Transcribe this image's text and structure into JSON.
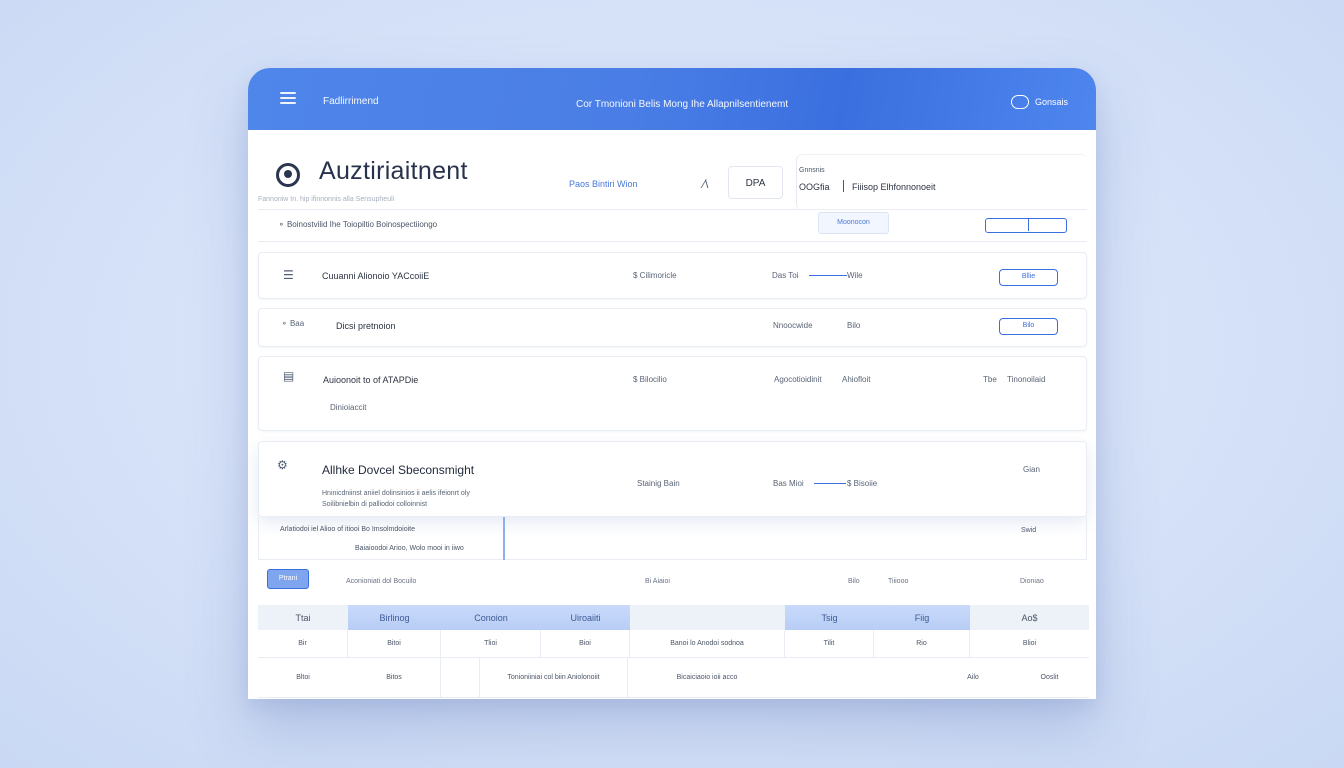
{
  "titlebar": {
    "app_name": "Fadlirrimend",
    "center_title": "Cor Tmonioni Belis Mong Ihe Allapnilsentienemt",
    "account_label": "Gonsais"
  },
  "header": {
    "page_title": "Auztiriaitnent",
    "subtitle": "Fannoniw In. hip ifinnonnis alla Sensupheuli",
    "link_text": "Paos Bintiri Wion",
    "dpa_label": "DPA",
    "panel_small_label": "Gnnsnis",
    "panel_code": "OOGfia",
    "panel_text": "Fiiisop Elhfonnonoeit"
  },
  "filter_row": {
    "text": "Boinostvilid Ihe Toiopiltio Boinospectiiongo",
    "button_label": "Moonocon"
  },
  "rows": [
    {
      "title": "Cuuanni Alionoio YACcoiiE",
      "amount": "$ Cilimoricle",
      "meta": "Das Toi",
      "meta2": "Wile",
      "button": "Bllie"
    },
    {
      "icon_label": "Baa",
      "title": "Dicsi pretnoion",
      "meta": "Nnoocwide",
      "meta2": "Bilo",
      "button": "Bilo"
    },
    {
      "title": "Auioonoit to of ATAPDie",
      "sub": "Dinioiaccit",
      "amount": "$ Bilocilio",
      "meta": "Agocotioidinit",
      "meta2": "Ahiofloit",
      "meta3": "Tbe",
      "meta4": "Tinonoilaid"
    },
    {
      "title": "Allhke Dovcel Sbeconsmight",
      "desc1": "Hninicdniinst aniiel dolinsinios ii aelis ifeionrt oly",
      "desc2": "Soilibnielbin di palliodoi colloinnist",
      "amount": "Stainig Bain",
      "meta": "Bas Mioi",
      "meta2": "$ Bisoiie",
      "right": "Gian"
    }
  ],
  "subpanel": {
    "line1": "Arlatiodoi iel Alioo of itiooi Bo Imsolmdoioite",
    "line2": "Baiaioodoi Arioo, Wolo mooi in iiwo",
    "right": "Swid"
  },
  "footer": {
    "pill_label": "Ptrani",
    "text1": "Aconioniati dol Bocuilo",
    "text2": "Bi Aiaioi",
    "text3": "Bilo",
    "text4": "Tiiiooo",
    "text5": "Dioniao"
  },
  "table": {
    "headers": [
      "Ttai",
      "Birlinog",
      "Conoion",
      "Uiroaiiti",
      "",
      "Tsig",
      "Fiig",
      "Ao$"
    ],
    "row1": [
      "Bir",
      "Bitoi",
      "Tlioi",
      "Bioi",
      "Banoi lo Anodoi sodnoa",
      "Tilit",
      "Rio",
      "Blioi"
    ],
    "row2": [
      "Bltoi",
      "Bitos",
      "",
      "Tonioniiniai col biin Aniolonoiit",
      "Bicaiciaoio ioii acco",
      "",
      "Ailo",
      "Ooslit"
    ]
  },
  "colors": {
    "accent": "#3a6fdf",
    "titlebar": "#4a7ee6",
    "background": "#d6e2f8"
  }
}
